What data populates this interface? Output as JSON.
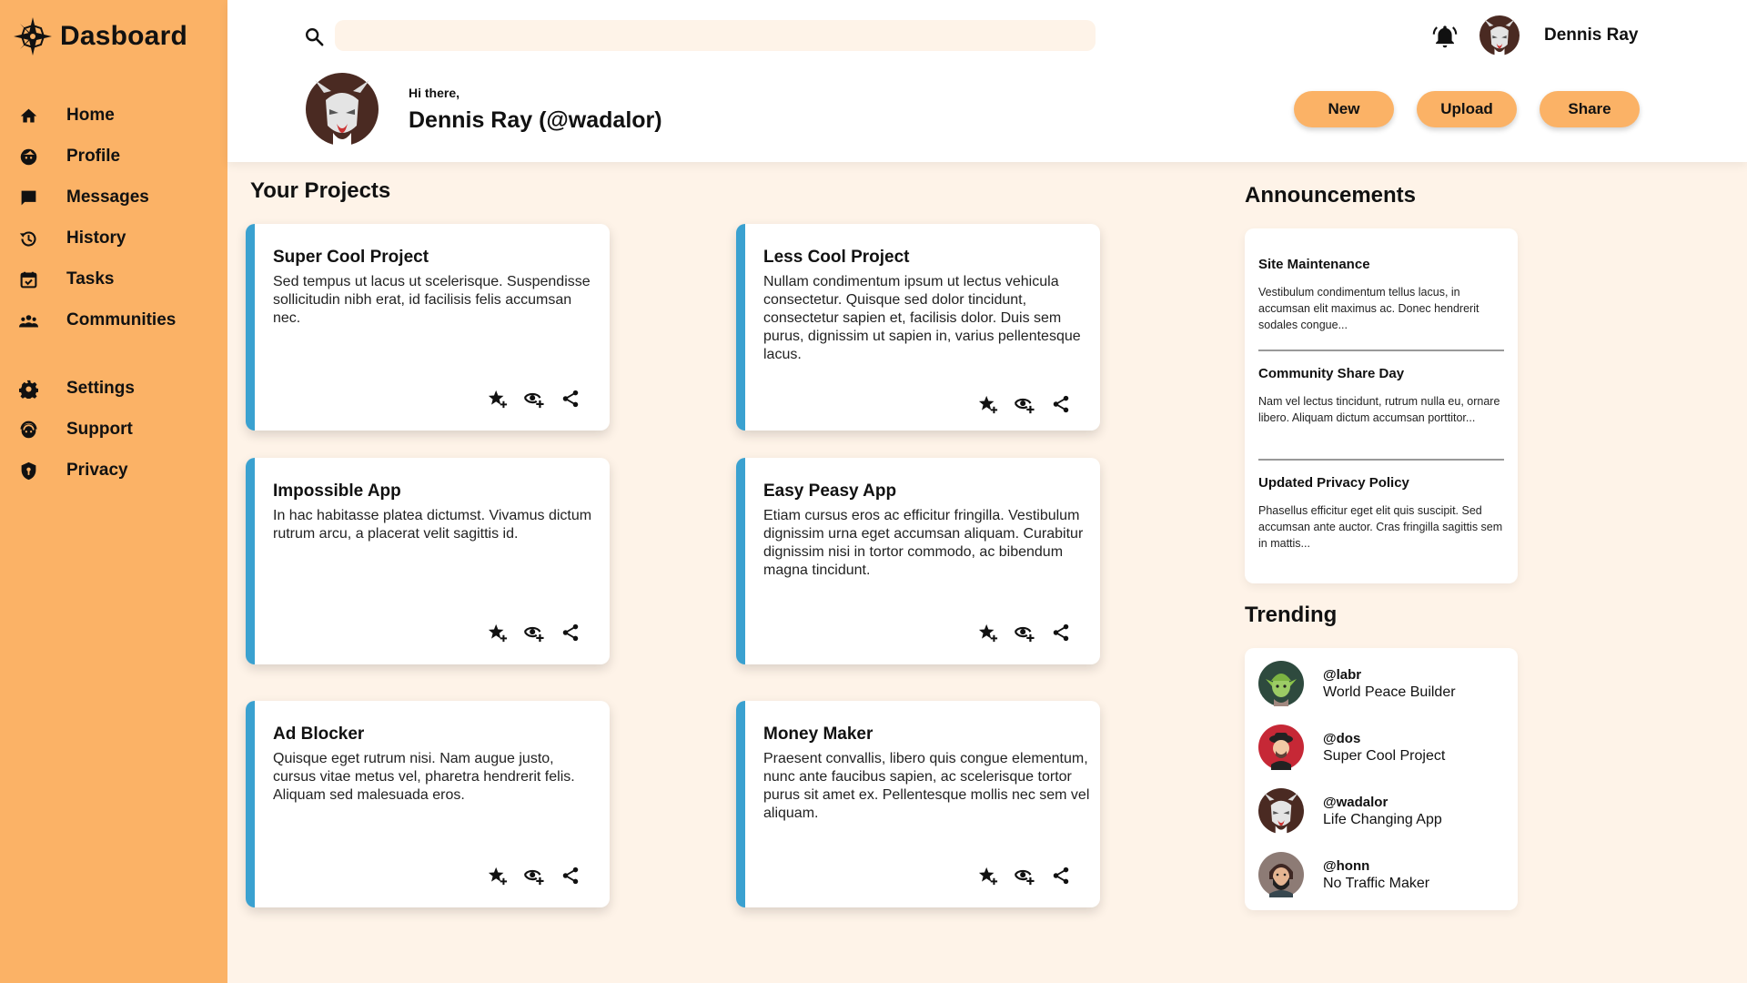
{
  "app": {
    "title": "Dasboard"
  },
  "nav": {
    "primary": [
      {
        "label": "Home",
        "icon": "home-icon"
      },
      {
        "label": "Profile",
        "icon": "face-icon"
      },
      {
        "label": "Messages",
        "icon": "message-icon"
      },
      {
        "label": "History",
        "icon": "history-icon"
      },
      {
        "label": "Tasks",
        "icon": "calendar-check-icon"
      },
      {
        "label": "Communities",
        "icon": "people-icon"
      }
    ],
    "secondary": [
      {
        "label": "Settings",
        "icon": "gear-icon"
      },
      {
        "label": "Support",
        "icon": "support-icon"
      },
      {
        "label": "Privacy",
        "icon": "shield-icon"
      }
    ]
  },
  "header": {
    "search": {
      "placeholder": "",
      "value": ""
    },
    "user_name": "Dennis Ray",
    "greeting": "Hi there,",
    "display_name": "Dennis Ray (@wadalor)",
    "buttons": {
      "new": "New",
      "upload": "Upload",
      "share": "Share"
    }
  },
  "projects": {
    "title": "Your Projects",
    "items": [
      {
        "title": "Super Cool Project",
        "desc": "Sed tempus ut lacus ut scelerisque. Suspendisse sollicitudin nibh erat, id facilisis felis accumsan nec."
      },
      {
        "title": "Less Cool Project",
        "desc": "Nullam condimentum ipsum ut lectus vehicula consectetur. Quisque sed dolor tincidunt, consectetur sapien et, facilisis dolor. Duis sem purus, dignissim ut sapien in, varius pellentesque lacus."
      },
      {
        "title": "Impossible App",
        "desc": "In hac habitasse platea dictumst. Vivamus dictum rutrum arcu, a placerat velit sagittis id."
      },
      {
        "title": "Easy Peasy App",
        "desc": "Etiam cursus eros ac efficitur fringilla. Vestibulum dignissim urna eget accumsan aliquam. Curabitur dignissim nisi in tortor commodo, ac bibendum magna tincidunt."
      },
      {
        "title": "Ad Blocker",
        "desc": "Quisque eget rutrum nisi. Nam augue justo, cursus vitae metus vel, pharetra hendrerit felis. Aliquam sed malesuada eros."
      },
      {
        "title": "Money Maker",
        "desc": "Praesent convallis, libero quis congue elementum, nunc ante faucibus sapien, ac scelerisque tortor purus sit amet ex. Pellentesque mollis nec sem vel aliquam."
      }
    ],
    "actions": [
      "star-add-icon",
      "watch-add-icon",
      "share-icon"
    ]
  },
  "announcements": {
    "title": "Announcements",
    "items": [
      {
        "title": "Site Maintenance",
        "body": "Vestibulum condimentum tellus lacus, in accumsan elit maximus ac. Donec hendrerit sodales congue..."
      },
      {
        "title": "Community Share Day",
        "body": "Nam vel lectus tincidunt, rutrum nulla eu, ornare libero. Aliquam dictum accumsan porttitor..."
      },
      {
        "title": "Updated Privacy Policy",
        "body": "Phasellus efficitur eget elit quis suscipit. Sed accumsan ante auctor. Cras fringilla sagittis sem in mattis..."
      }
    ]
  },
  "trending": {
    "title": "Trending",
    "items": [
      {
        "handle": "@labr",
        "project": "World Peace Builder"
      },
      {
        "handle": "@dos",
        "project": "Super Cool Project"
      },
      {
        "handle": "@wadalor",
        "project": "Life Changing App"
      },
      {
        "handle": "@honn",
        "project": "No Traffic Maker"
      }
    ]
  },
  "colors": {
    "sidebar": "#fbb266",
    "accent_button": "#fbb266",
    "card_stripe": "#3aa1d0",
    "page_background": "#fef3e8",
    "header_background": "#ffffff"
  }
}
